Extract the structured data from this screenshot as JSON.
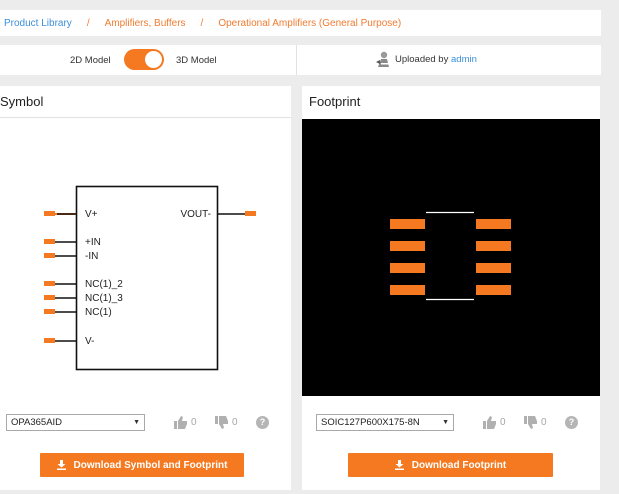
{
  "breadcrumb": {
    "items": [
      "Product Library",
      "Amplifiers, Buffers",
      "Operational Amplifiers (General Purpose)"
    ],
    "separator": "/"
  },
  "model_toggle": {
    "left_label": "2D Model",
    "right_label": "3D Model",
    "state": "3D Model",
    "color": "#f47920"
  },
  "upload": {
    "prefix": "Uploaded by",
    "user": "admin"
  },
  "symbol_panel": {
    "title": "Symbol",
    "pins_left": [
      "V+",
      "+IN",
      "-IN",
      "NC(1)_2",
      "NC(1)_3",
      "NC(1)",
      "V-"
    ],
    "pins_right": [
      "VOUT-"
    ],
    "part_select": "OPA365AID",
    "likes": "0",
    "dislikes": "0",
    "help_icon": "?",
    "download_label": "Download Symbol and Footprint"
  },
  "footprint_panel": {
    "title": "Footprint",
    "pad_count": 8,
    "package_select": "SOIC127P600X175-8N",
    "likes": "0",
    "dislikes": "0",
    "help_icon": "?",
    "download_label": "Download Footprint"
  },
  "colors": {
    "accent": "#f47920",
    "link": "#3a8fd8",
    "footprint_bg": "#000000"
  },
  "icons": {
    "upload": "person-upload-icon",
    "like": "thumbs-up-icon",
    "dislike": "thumbs-down-icon",
    "help": "question-circle-icon",
    "download": "download-icon"
  }
}
